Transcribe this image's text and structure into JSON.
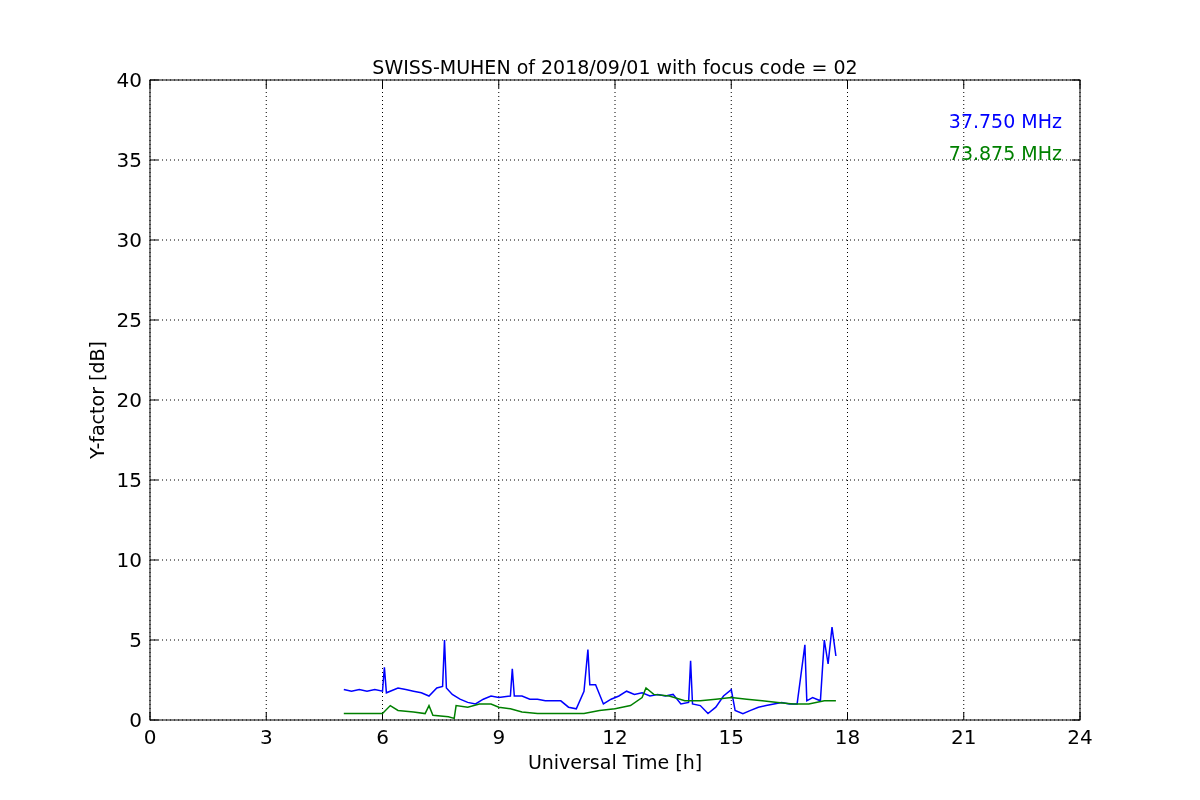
{
  "chart_data": {
    "type": "line",
    "grid": true,
    "title": "SWISS-MUHEN of 2018/09/01 with focus code = 02",
    "xlabel": "Universal Time [h]",
    "ylabel": "Y-factor [dB]",
    "xlim": [
      0,
      24
    ],
    "ylim": [
      0,
      40
    ],
    "xticks": [
      0,
      3,
      6,
      9,
      12,
      15,
      18,
      21,
      24
    ],
    "yticks": [
      0,
      5,
      10,
      15,
      20,
      25,
      30,
      35,
      40
    ],
    "series": [
      {
        "name": "37.750 MHz",
        "color": "#0000ff",
        "x": [
          5.0,
          5.2,
          5.4,
          5.6,
          5.8,
          6.0,
          6.05,
          6.1,
          6.4,
          6.6,
          6.8,
          7.0,
          7.2,
          7.4,
          7.55,
          7.6,
          7.65,
          7.8,
          8.0,
          8.2,
          8.4,
          8.6,
          8.8,
          9.0,
          9.3,
          9.35,
          9.4,
          9.6,
          9.8,
          10.0,
          10.2,
          10.4,
          10.6,
          10.8,
          11.0,
          11.2,
          11.3,
          11.35,
          11.5,
          11.7,
          11.9,
          12.1,
          12.3,
          12.5,
          12.7,
          12.9,
          13.1,
          13.3,
          13.5,
          13.7,
          13.9,
          13.95,
          14.0,
          14.2,
          14.4,
          14.6,
          14.8,
          15.0,
          15.1,
          15.3,
          15.5,
          15.7,
          15.9,
          16.1,
          16.3,
          16.5,
          16.7,
          16.9,
          16.95,
          17.1,
          17.3,
          17.4,
          17.5,
          17.6,
          17.7
        ],
        "values": [
          1.9,
          1.8,
          1.9,
          1.8,
          1.9,
          1.8,
          3.3,
          1.7,
          2.0,
          1.9,
          1.8,
          1.7,
          1.5,
          2.0,
          2.1,
          5.0,
          2.0,
          1.6,
          1.3,
          1.1,
          1.0,
          1.3,
          1.5,
          1.4,
          1.5,
          3.2,
          1.5,
          1.5,
          1.3,
          1.3,
          1.2,
          1.2,
          1.2,
          0.8,
          0.7,
          1.8,
          4.4,
          2.2,
          2.2,
          1.0,
          1.3,
          1.5,
          1.8,
          1.6,
          1.7,
          1.5,
          1.6,
          1.5,
          1.6,
          1.0,
          1.1,
          3.7,
          1.0,
          0.9,
          0.4,
          0.8,
          1.5,
          1.9,
          0.6,
          0.4,
          0.6,
          0.8,
          0.9,
          1.0,
          1.1,
          1.0,
          1.0,
          4.7,
          1.2,
          1.4,
          1.2,
          5.0,
          3.5,
          5.8,
          4.0
        ]
      },
      {
        "name": "73.875 MHz",
        "color": "#008000",
        "x": [
          5.0,
          5.5,
          6.0,
          6.2,
          6.4,
          6.8,
          7.1,
          7.2,
          7.3,
          7.7,
          7.85,
          7.9,
          8.2,
          8.5,
          8.8,
          9.0,
          9.3,
          9.6,
          10.0,
          10.4,
          10.8,
          11.2,
          11.6,
          12.0,
          12.4,
          12.7,
          12.8,
          13.0,
          13.4,
          13.8,
          14.2,
          14.6,
          15.0,
          15.4,
          15.8,
          16.2,
          16.6,
          17.0,
          17.4,
          17.7
        ],
        "values": [
          0.4,
          0.4,
          0.4,
          0.9,
          0.6,
          0.5,
          0.4,
          0.9,
          0.3,
          0.2,
          0.1,
          0.9,
          0.8,
          1.0,
          1.0,
          0.8,
          0.7,
          0.5,
          0.4,
          0.4,
          0.4,
          0.4,
          0.6,
          0.7,
          0.9,
          1.4,
          2.0,
          1.6,
          1.5,
          1.2,
          1.2,
          1.3,
          1.4,
          1.3,
          1.2,
          1.1,
          1.0,
          1.0,
          1.2,
          1.2
        ]
      }
    ]
  }
}
